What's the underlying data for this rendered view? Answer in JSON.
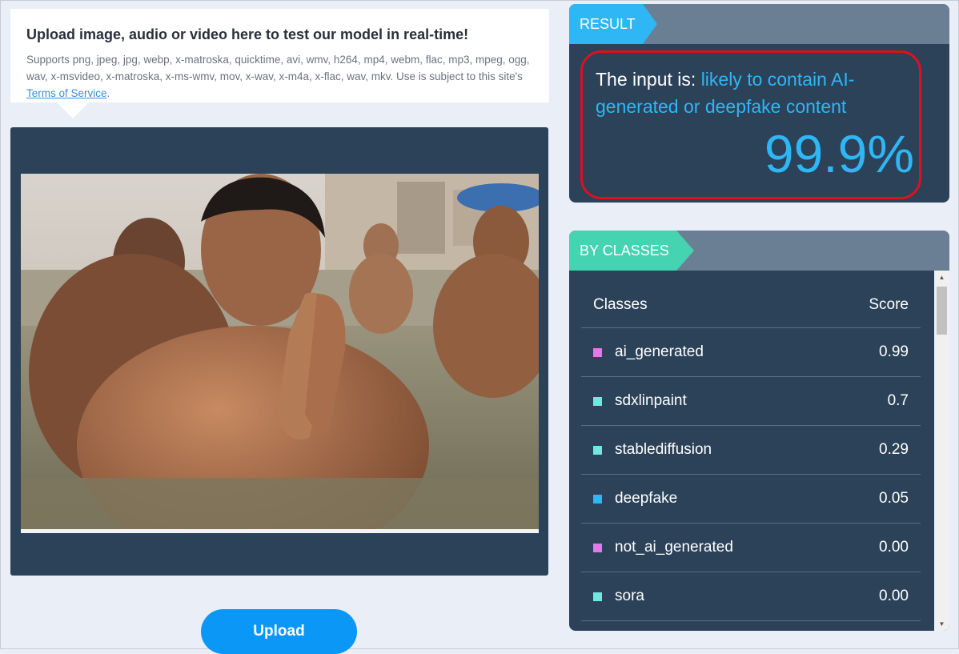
{
  "upload_info": {
    "title": "Upload image, audio or video here to test our model in real-time!",
    "supported_text": "Supports png, jpeg, jpg, webp, x-matroska, quicktime, avi, wmv, h264, mp4, webm, flac, mp3, mpeg, ogg, wav, x-msvideo, x-matroska, x-ms-wmv, mov, x-wav, x-m4a, x-flac, wav, mkv. Use is subject to this site's ",
    "terms_link": "Terms of Service",
    "after_link": "."
  },
  "upload_button": {
    "label": "Upload"
  },
  "result": {
    "tag": "RESULT",
    "prefix": "The input is: ",
    "verdict": "likely to contain AI-generated or deepfake content",
    "percent": "99.9%",
    "accent_color": "#2fb6f5",
    "highlight_color": "#e0101e"
  },
  "classes": {
    "tag": "BY CLASSES",
    "header": {
      "name": "Classes",
      "score": "Score"
    },
    "rows": [
      {
        "name": "ai_generated",
        "score": "0.99",
        "color": "#e07ae6"
      },
      {
        "name": "sdxlinpaint",
        "score": "0.7",
        "color": "#6fe8e0"
      },
      {
        "name": "stablediffusion",
        "score": "0.29",
        "color": "#6fe8e0"
      },
      {
        "name": "deepfake",
        "score": "0.05",
        "color": "#2fb6f5"
      },
      {
        "name": "not_ai_generated",
        "score": "0.00",
        "color": "#e07ae6"
      },
      {
        "name": "sora",
        "score": "0.00",
        "color": "#6fe8e0"
      }
    ]
  }
}
